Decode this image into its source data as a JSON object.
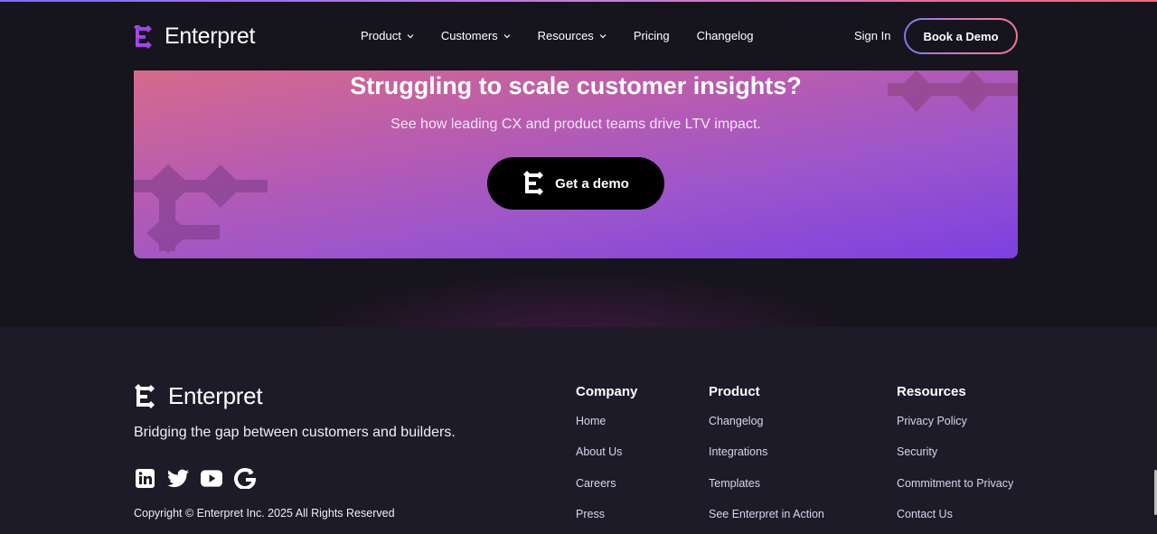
{
  "header": {
    "brand": "Enterpret",
    "nav": [
      {
        "label": "Product",
        "has_menu": true
      },
      {
        "label": "Customers",
        "has_menu": true
      },
      {
        "label": "Resources",
        "has_menu": true
      },
      {
        "label": "Pricing",
        "has_menu": false
      },
      {
        "label": "Changelog",
        "has_menu": false
      }
    ],
    "sign_in": "Sign In",
    "book_demo": "Book a Demo"
  },
  "cta": {
    "title": "Struggling to scale customer insights?",
    "subtitle": "See how leading CX and product teams drive LTV impact.",
    "button": "Get a demo"
  },
  "footer": {
    "brand": "Enterpret",
    "tagline": "Bridging the gap between customers and builders.",
    "socials": [
      "linkedin-icon",
      "twitter-icon",
      "youtube-icon",
      "g2-icon"
    ],
    "copyright": "Copyright © Enterpret Inc. 2025 All Rights Reserved",
    "columns": [
      {
        "title": "Company",
        "links": [
          "Home",
          "About Us",
          "Careers",
          "Press"
        ]
      },
      {
        "title": "Product",
        "links": [
          "Changelog",
          "Integrations",
          "Templates",
          "See Enterpret in Action"
        ]
      },
      {
        "title": "Resources",
        "links": [
          "Privacy Policy",
          "Security",
          "Commitment to Privacy",
          "Contact Us"
        ]
      }
    ]
  },
  "colors": {
    "background": "#16141c",
    "footer_bg": "#1e1b28",
    "banner_start": "#d66a8c",
    "banner_end": "#7d40e0",
    "brand_purple": "#8b3fe6"
  }
}
